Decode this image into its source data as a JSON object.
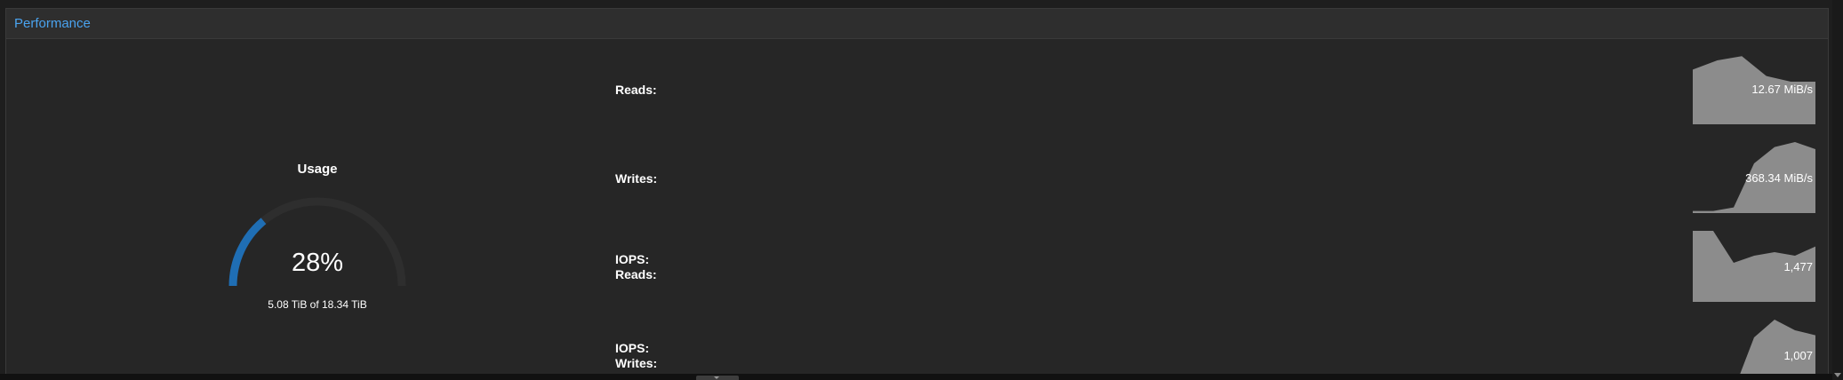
{
  "panel": {
    "title": "Performance"
  },
  "usage": {
    "title": "Usage",
    "percent": 28,
    "percent_label": "28%",
    "detail": "5.08 TiB of 18.34 TiB",
    "colors": {
      "fill": "#1f6eb4",
      "track": "#2e2e2e"
    }
  },
  "metrics": [
    {
      "label_lines": [
        "Reads:"
      ],
      "value": "12.67 MiB/s",
      "sparkline": [
        0.77,
        0.9,
        0.96,
        0.68,
        0.6,
        0.6
      ]
    },
    {
      "label_lines": [
        "Writes:"
      ],
      "value": "368.34 MiB/s",
      "sparkline": [
        0.03,
        0.03,
        0.08,
        0.7,
        0.93,
        1.0,
        0.9
      ]
    },
    {
      "label_lines": [
        "IOPS:",
        "Reads:"
      ],
      "value": "1,477",
      "sparkline": [
        1.0,
        1.0,
        0.55,
        0.65,
        0.7,
        0.65,
        0.78
      ]
    },
    {
      "label_lines": [
        "IOPS:",
        "Writes:"
      ],
      "value": "1,007",
      "sparkline": [
        0.03,
        0.03,
        0.0,
        0.75,
        1.0,
        0.85,
        0.78
      ]
    }
  ],
  "sparkline_color": "#8c8c8c"
}
